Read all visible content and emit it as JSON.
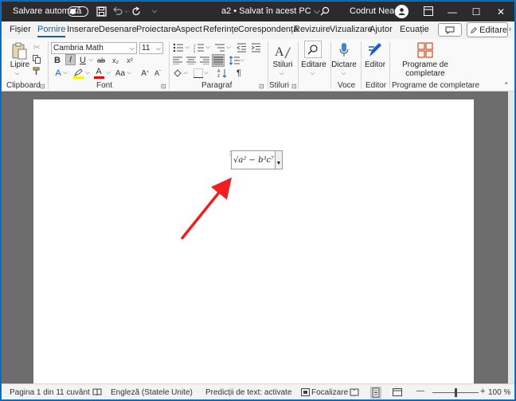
{
  "titlebar": {
    "autosave_label": "Salvare automată",
    "autosave_state": "off",
    "doc_title": "a2 • Salvat în acest PC ⌵",
    "user_name": "Codrut Neagu",
    "minimize": "—",
    "maximize": "☐",
    "close": "✕"
  },
  "tabs": [
    "Fișier",
    "Pornire",
    "Inserare",
    "Desenare",
    "Proiectare",
    "Aspect",
    "Referințe",
    "Corespondență",
    "Revizuire",
    "Vizualizare",
    "Ajutor",
    "Ecuație"
  ],
  "active_tab": "Pornire",
  "edit_button_label": "Editare",
  "ribbon": {
    "clipboard": {
      "paste_label": "Lipire",
      "group_label": "Clipboard"
    },
    "font": {
      "font_name": "Cambria Math",
      "font_size": "11",
      "group_label": "Font",
      "bold": "B",
      "italic": "I",
      "underline": "U",
      "strike": "ab",
      "subscript": "x₂",
      "superscript": "x²",
      "grow": "A^",
      "shrink": "Aˇ",
      "case": "Aa",
      "clear": "A",
      "font_color": "A",
      "highlight": "ab"
    },
    "paragraph": {
      "group_label": "Paragraf"
    },
    "styles": {
      "label": "Stiluri",
      "group_label": "Stiluri"
    },
    "editing": {
      "label": "Editare",
      "group_label": ""
    },
    "voice": {
      "label": "Dictare",
      "group_label": "Voce"
    },
    "editor": {
      "label": "Editor",
      "group_label": "Editor"
    },
    "addins": {
      "label_line1": "Programe de",
      "label_line2": "completare",
      "group_label": "Programe de completare"
    }
  },
  "equation": {
    "text": "√a² − b³c⁷"
  },
  "statusbar": {
    "page": "Pagina 1 din 1",
    "words": "1 cuvânt",
    "language": "Engleză (Statele Unite)",
    "predictions": "Predicții de text: activate",
    "focus": "Focalizare",
    "zoom": "100 %",
    "zoom_minus": "—",
    "zoom_plus": "+"
  },
  "colors": {
    "titlebar": "#2b2b2b",
    "accent": "#185abd",
    "doc_background": "#6d6d6d",
    "arrow": "#f01e1e",
    "font_color_bar": "#e00000",
    "highlight_bar": "#f5f500"
  }
}
